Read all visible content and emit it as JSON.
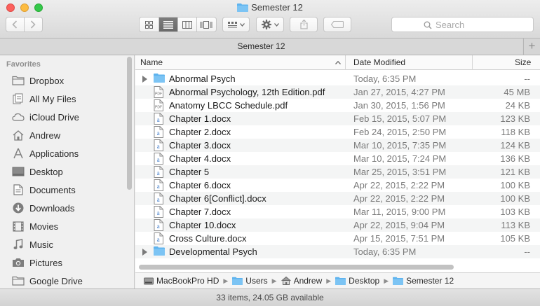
{
  "window": {
    "title": "Semester 12"
  },
  "toolbar": {
    "back": "back",
    "forward": "forward",
    "view_icon": "icon-view",
    "view_list": "list-view",
    "view_column": "column-view",
    "view_coverflow": "coverflow-view",
    "arrange": "arrange",
    "action": "action",
    "share": "share",
    "tags": "tags",
    "search_placeholder": "Search"
  },
  "tabbar": {
    "tab_label": "Semester 12",
    "add_label": "+"
  },
  "sidebar": {
    "heading": "Favorites",
    "items": [
      {
        "label": "Dropbox",
        "icon": "folder-icon"
      },
      {
        "label": "All My Files",
        "icon": "all-files-icon"
      },
      {
        "label": "iCloud Drive",
        "icon": "cloud-icon"
      },
      {
        "label": "Andrew",
        "icon": "home-icon"
      },
      {
        "label": "Applications",
        "icon": "applications-icon"
      },
      {
        "label": "Desktop",
        "icon": "desktop-icon"
      },
      {
        "label": "Documents",
        "icon": "documents-icon"
      },
      {
        "label": "Downloads",
        "icon": "downloads-icon"
      },
      {
        "label": "Movies",
        "icon": "movies-icon"
      },
      {
        "label": "Music",
        "icon": "music-icon"
      },
      {
        "label": "Pictures",
        "icon": "pictures-icon"
      },
      {
        "label": "Google Drive",
        "icon": "folder-icon"
      }
    ]
  },
  "list": {
    "columns": {
      "name": "Name",
      "date": "Date Modified",
      "size": "Size"
    },
    "rows": [
      {
        "name": "Abnormal Psych",
        "date": "Today, 6:35 PM",
        "size": "--",
        "kind": "folder"
      },
      {
        "name": "Abnormal Psychology, 12th Edition.pdf",
        "date": "Jan 27, 2015, 4:27 PM",
        "size": "45 MB",
        "kind": "pdf"
      },
      {
        "name": "Anatomy LBCC Schedule.pdf",
        "date": "Jan 30, 2015, 1:56 PM",
        "size": "24 KB",
        "kind": "pdf"
      },
      {
        "name": "Chapter 1.docx",
        "date": "Feb 15, 2015, 5:07 PM",
        "size": "123 KB",
        "kind": "doc"
      },
      {
        "name": "Chapter 2.docx",
        "date": "Feb 24, 2015, 2:50 PM",
        "size": "118 KB",
        "kind": "doc"
      },
      {
        "name": "Chapter 3.docx",
        "date": "Mar 10, 2015, 7:35 PM",
        "size": "124 KB",
        "kind": "doc"
      },
      {
        "name": "Chapter 4.docx",
        "date": "Mar 10, 2015, 7:24 PM",
        "size": "136 KB",
        "kind": "doc"
      },
      {
        "name": "Chapter 5",
        "date": "Mar 25, 2015, 3:51 PM",
        "size": "121 KB",
        "kind": "doc"
      },
      {
        "name": "Chapter 6.docx",
        "date": "Apr 22, 2015, 2:22 PM",
        "size": "100 KB",
        "kind": "doc"
      },
      {
        "name": "Chapter 6[Conflict].docx",
        "date": "Apr 22, 2015, 2:22 PM",
        "size": "100 KB",
        "kind": "doc"
      },
      {
        "name": "Chapter 7.docx",
        "date": "Mar 11, 2015, 9:00 PM",
        "size": "103 KB",
        "kind": "doc"
      },
      {
        "name": "Chapter 10.docx",
        "date": "Apr 22, 2015, 9:04 PM",
        "size": "113 KB",
        "kind": "doc"
      },
      {
        "name": "Cross Culture.docx",
        "date": "Apr 15, 2015, 7:51 PM",
        "size": "105 KB",
        "kind": "doc"
      },
      {
        "name": "Developmental Psych",
        "date": "Today, 6:35 PM",
        "size": "--",
        "kind": "folder"
      }
    ]
  },
  "pathbar": {
    "crumbs": [
      {
        "label": "MacBookPro HD",
        "icon": "hard-drive-icon"
      },
      {
        "label": "Users",
        "icon": "folder-icon"
      },
      {
        "label": "Andrew",
        "icon": "home-icon"
      },
      {
        "label": "Desktop",
        "icon": "folder-icon"
      },
      {
        "label": "Semester 12",
        "icon": "folder-icon"
      }
    ]
  },
  "status": {
    "text": "33 items, 24.05 GB available"
  },
  "colors": {
    "folder": "#5eb3ee",
    "close": "#fc605c",
    "minimize": "#fdbc40",
    "zoom": "#34c84a"
  }
}
